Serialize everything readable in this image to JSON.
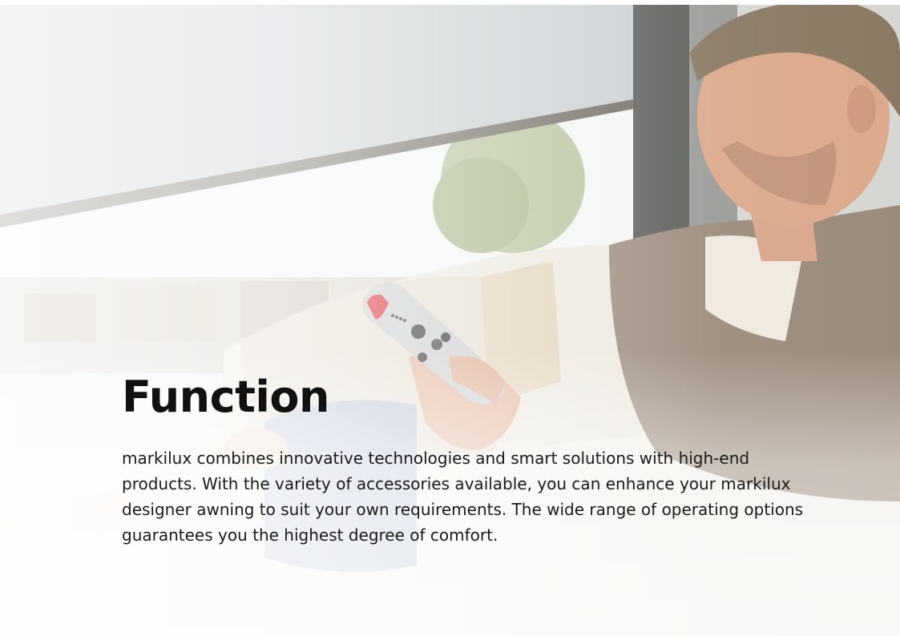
{
  "hero": {
    "image_alt": "Man on a sofa holding a markilux remote control in front of a window with a lowered screen",
    "title": "Function",
    "body": "markilux combines innovative technologies and smart solutions with high-end products. With the variety of accessories available, you can enhance your markilux designer awning to suit your own requirements. The wide range of operating options guarantees you the highest degree of comfort."
  },
  "colors": {
    "title_text": "#111111",
    "body_text": "#1a1a1a",
    "remote_accent": "#d8232a"
  },
  "icons": [
    "remote-control-icon"
  ]
}
